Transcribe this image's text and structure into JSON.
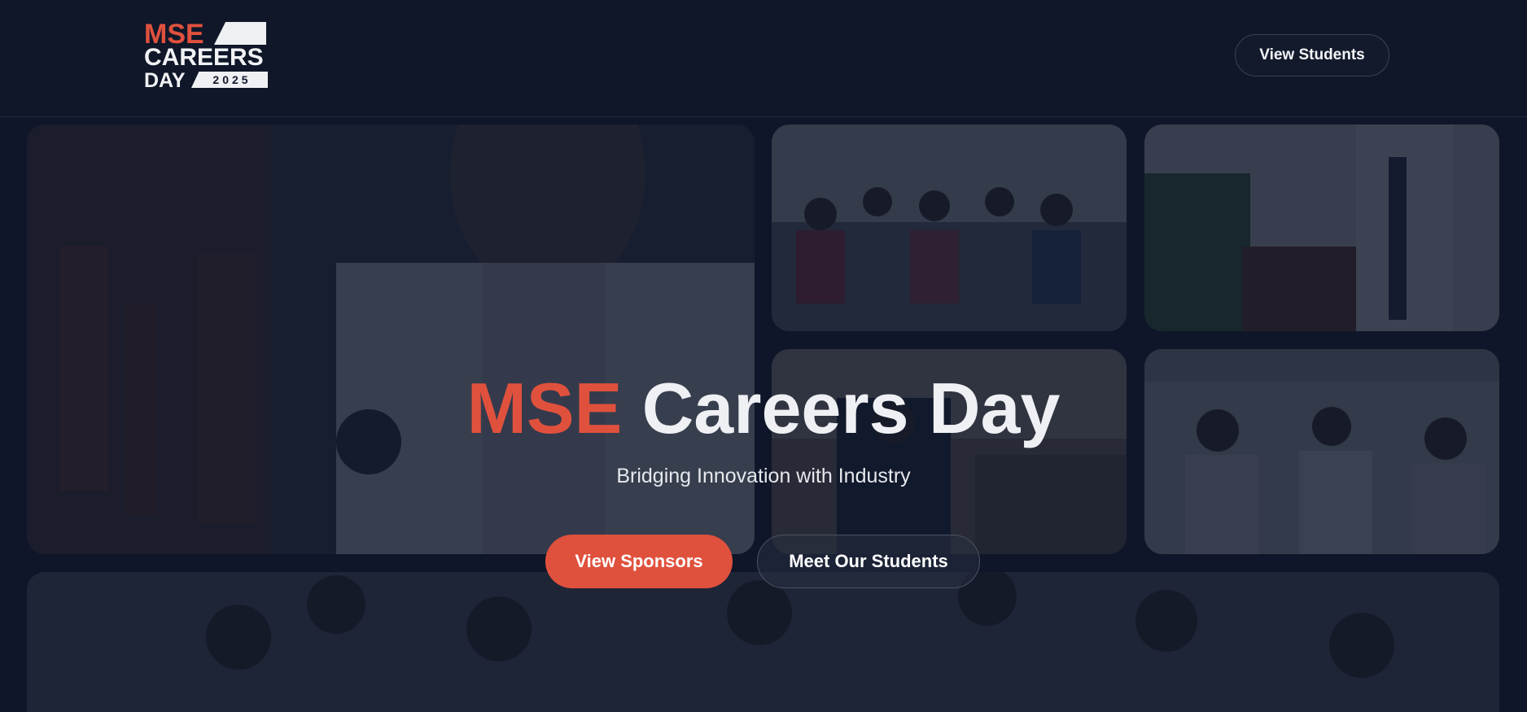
{
  "header": {
    "logo": {
      "line1": "MSE",
      "line2": "CAREERS",
      "line3": "DAY",
      "year": "2025"
    },
    "view_students_label": "View Students"
  },
  "hero": {
    "title_accent": "MSE",
    "title_rest": "Careers Day",
    "subtitle": "Bridging Innovation with Industry",
    "primary_button_label": "View Sponsors",
    "secondary_button_label": "Meet Our Students"
  },
  "colors": {
    "background": "#0f1729",
    "accent": "#e0513d",
    "text": "#eef0f3"
  }
}
